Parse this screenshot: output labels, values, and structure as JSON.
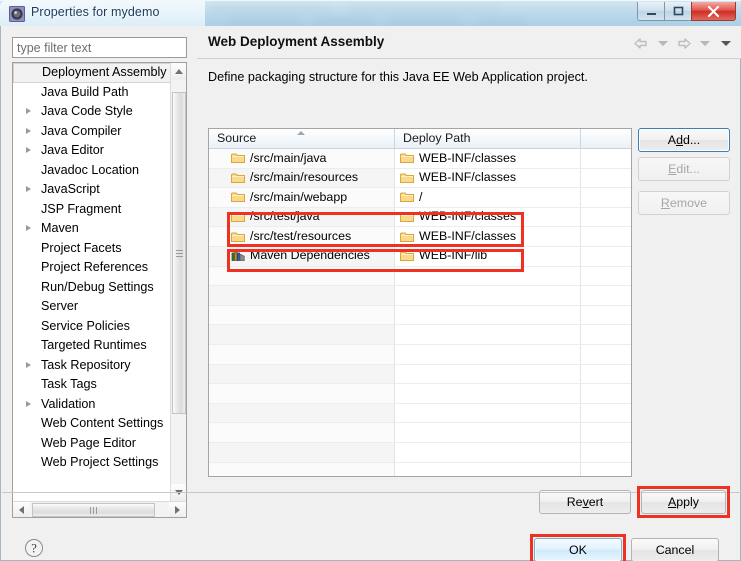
{
  "window": {
    "title": "Properties for mydemo",
    "app_icon": "eclipse-properties-icon",
    "controls": {
      "minimize": "minimize-button",
      "maximize": "maximize-button",
      "close": "close-button"
    }
  },
  "sidebar": {
    "filter": {
      "placeholder": "type filter text",
      "value": ""
    },
    "items": [
      {
        "label": "Deployment Assembly",
        "expandable": false,
        "selected": true
      },
      {
        "label": "Java Build Path",
        "expandable": false,
        "selected": false
      },
      {
        "label": "Java Code Style",
        "expandable": true,
        "selected": false
      },
      {
        "label": "Java Compiler",
        "expandable": true,
        "selected": false
      },
      {
        "label": "Java Editor",
        "expandable": true,
        "selected": false
      },
      {
        "label": "Javadoc Location",
        "expandable": false,
        "selected": false
      },
      {
        "label": "JavaScript",
        "expandable": true,
        "selected": false
      },
      {
        "label": "JSP Fragment",
        "expandable": false,
        "selected": false
      },
      {
        "label": "Maven",
        "expandable": true,
        "selected": false
      },
      {
        "label": "Project Facets",
        "expandable": false,
        "selected": false
      },
      {
        "label": "Project References",
        "expandable": false,
        "selected": false
      },
      {
        "label": "Run/Debug Settings",
        "expandable": false,
        "selected": false
      },
      {
        "label": "Server",
        "expandable": false,
        "selected": false
      },
      {
        "label": "Service Policies",
        "expandable": false,
        "selected": false
      },
      {
        "label": "Targeted Runtimes",
        "expandable": false,
        "selected": false
      },
      {
        "label": "Task Repository",
        "expandable": true,
        "selected": false
      },
      {
        "label": "Task Tags",
        "expandable": false,
        "selected": false
      },
      {
        "label": "Validation",
        "expandable": true,
        "selected": false
      },
      {
        "label": "Web Content Settings",
        "expandable": false,
        "selected": false
      },
      {
        "label": "Web Page Editor",
        "expandable": false,
        "selected": false
      },
      {
        "label": "Web Project Settings",
        "expandable": false,
        "selected": false
      }
    ]
  },
  "page": {
    "title": "Web Deployment Assembly",
    "description": "Define packaging structure for this Java EE Web Application project.",
    "nav": {
      "back_icon": "back-arrow-icon",
      "back_menu_icon": "chevron-down-icon",
      "forward_icon": "forward-arrow-icon",
      "forward_menu_icon": "chevron-down-icon",
      "view_menu_icon": "chevron-down-icon"
    }
  },
  "table": {
    "columns": [
      {
        "label": "Source",
        "sorted": true,
        "sort_icon": "sort-ascending-icon"
      },
      {
        "label": "Deploy Path",
        "sorted": false
      },
      {
        "label": "",
        "sorted": false
      }
    ],
    "rows": [
      {
        "icon": "folder-icon",
        "source": "/src/main/java",
        "deploy_icon": "folder-icon",
        "deploy": "WEB-INF/classes",
        "highlighted": false
      },
      {
        "icon": "folder-icon",
        "source": "/src/main/resources",
        "deploy_icon": "folder-icon",
        "deploy": "WEB-INF/classes",
        "highlighted": false
      },
      {
        "icon": "folder-icon",
        "source": "/src/main/webapp",
        "deploy_icon": "folder-icon",
        "deploy": "/",
        "highlighted": false
      },
      {
        "icon": "folder-icon",
        "source": "/src/test/java",
        "deploy_icon": "folder-icon",
        "deploy": "WEB-INF/classes",
        "highlighted": true
      },
      {
        "icon": "folder-icon",
        "source": "/src/test/resources",
        "deploy_icon": "folder-icon",
        "deploy": "WEB-INF/classes",
        "highlighted": true
      },
      {
        "icon": "library-icon",
        "source": "Maven Dependencies",
        "deploy_icon": "folder-icon",
        "deploy": "WEB-INF/lib",
        "highlighted": true
      }
    ],
    "empty_row_count": 11
  },
  "side_buttons": [
    {
      "label": "Add...",
      "mnemonic": "d",
      "enabled": true,
      "focused": true,
      "name": "add-button"
    },
    {
      "label": "Edit...",
      "mnemonic": "E",
      "enabled": false,
      "focused": false,
      "name": "edit-button"
    },
    {
      "label": "Remove",
      "mnemonic": "R",
      "enabled": false,
      "focused": false,
      "name": "remove-button"
    }
  ],
  "page_buttons": {
    "revert": {
      "label": "Revert",
      "mnemonic": "v",
      "highlighted": false
    },
    "apply": {
      "label": "Apply",
      "mnemonic": "A",
      "highlighted": true
    }
  },
  "dialog_buttons": {
    "ok": {
      "label": "OK",
      "default": true,
      "highlighted": true
    },
    "cancel": {
      "label": "Cancel",
      "default": false,
      "highlighted": false
    }
  },
  "help": {
    "icon": "help-question-icon"
  },
  "colors": {
    "highlight_red": "#ef3124",
    "dialog_bg": "#f0f0f0",
    "table_bg": "#ffffff",
    "folder_icon": "#fcd887",
    "title_text": "#1c3c5c",
    "close_button": "#cf2f22"
  }
}
